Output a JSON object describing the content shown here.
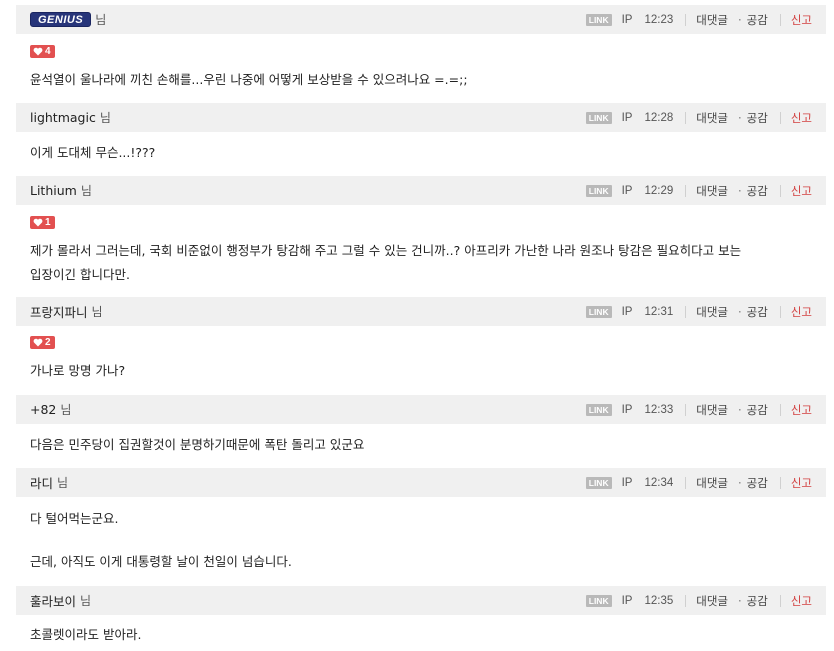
{
  "common": {
    "link_label": "LINK",
    "ip_label": "IP",
    "reply_label": "대댓글",
    "dot": "·",
    "like_label": "공감",
    "report_label": "신고",
    "honorific": "님"
  },
  "comments": [
    {
      "author": "GENIUS",
      "author_is_badge": true,
      "time": "12:23",
      "likes": "4",
      "lines": [
        "윤석열이 울나라에 끼친 손해를...우린 나중에 어떻게 보상받을 수 있으려나요 =.=;;"
      ]
    },
    {
      "author": "lightmagic",
      "time": "12:28",
      "lines": [
        "이게 도대체 무슨...!???"
      ]
    },
    {
      "author": "Lithium",
      "time": "12:29",
      "likes": "1",
      "lines": [
        "제가 몰라서 그러는데, 국회 비준없이 행정부가 탕감해 주고 그럴 수 있는 건니까..? 아프리카 가난한 나라 원조나 탕감은 필요히다고 보는",
        "입장이긴 합니다만."
      ]
    },
    {
      "author": "프랑지파니",
      "time": "12:31",
      "likes": "2",
      "lines": [
        "가나로 망명 가나?"
      ]
    },
    {
      "author": "+82",
      "time": "12:33",
      "lines": [
        "다음은 민주당이 집권할것이 분명하기때문에 폭탄 돌리고 있군요"
      ]
    },
    {
      "author": "라디",
      "time": "12:34",
      "lines": [
        "다 털어먹는군요.",
        "근데, 아직도 이게 대통령할 날이 천일이 넘습니다."
      ]
    },
    {
      "author": "훌라보이",
      "time": "12:35",
      "lines": [
        "초콜렛이라도 받아라."
      ]
    }
  ]
}
